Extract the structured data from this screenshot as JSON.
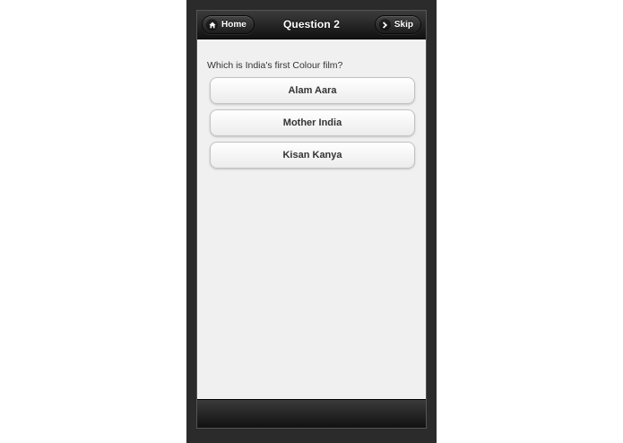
{
  "header": {
    "title": "Question 2",
    "home_label": "Home",
    "skip_label": "Skip"
  },
  "question": {
    "text": "Which is India's first Colour film?"
  },
  "options": [
    {
      "label": "Alam Aara"
    },
    {
      "label": "Mother India"
    },
    {
      "label": "Kisan Kanya"
    }
  ],
  "icons": {
    "home": "home-icon",
    "skip": "chevron-right-icon"
  },
  "colors": {
    "header_bg": "#1a1a1a",
    "content_bg": "#f0f0f0",
    "device_frame": "#2b2b2b"
  }
}
